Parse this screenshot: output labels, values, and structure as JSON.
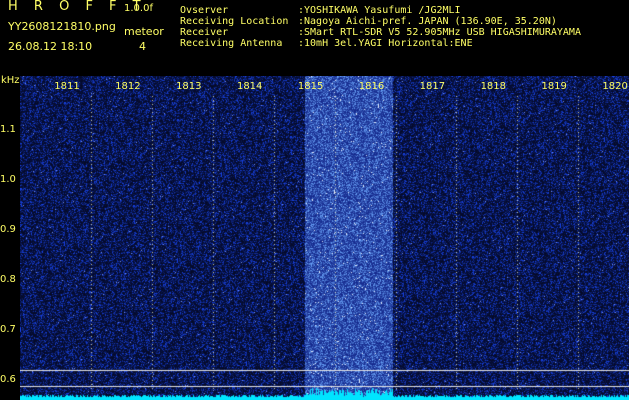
{
  "header": {
    "brand": "H R O F F T",
    "version": "1.0.0f",
    "filename": "YY2608121810.png",
    "meteor_label": "meteor",
    "datetime": "26.08.12 18:10",
    "meteor_count": "4"
  },
  "info": [
    {
      "label": "Ovserver",
      "value": ":YOSHIKAWA Yasufumi /JG2MLI"
    },
    {
      "label": "Receiving Location",
      "value": ":Nagoya Aichi-pref. JAPAN (136.90E, 35.20N)"
    },
    {
      "label": "Receiver",
      "value": ":SMart RTL-SDR V5 52.905MHz USB HIGASHIMURAYAMA"
    },
    {
      "label": "Receiving Antenna",
      "value": ":10mH 3el.YAGI Horizontal:ENE"
    }
  ],
  "plot": {
    "y_unit": "kHz",
    "y_ticks": [
      "1.1",
      "1.0",
      "0.9",
      "0.8",
      "0.7",
      "0.6"
    ],
    "x_ticks": [
      "1811",
      "1812",
      "1813",
      "1814",
      "1815",
      "1816",
      "1817",
      "1818",
      "1819",
      "1820"
    ],
    "colors": {
      "background": "#000000",
      "noise": "#1a2aff",
      "text": "#ffff66",
      "baseline": "#00e5ff"
    }
  }
}
